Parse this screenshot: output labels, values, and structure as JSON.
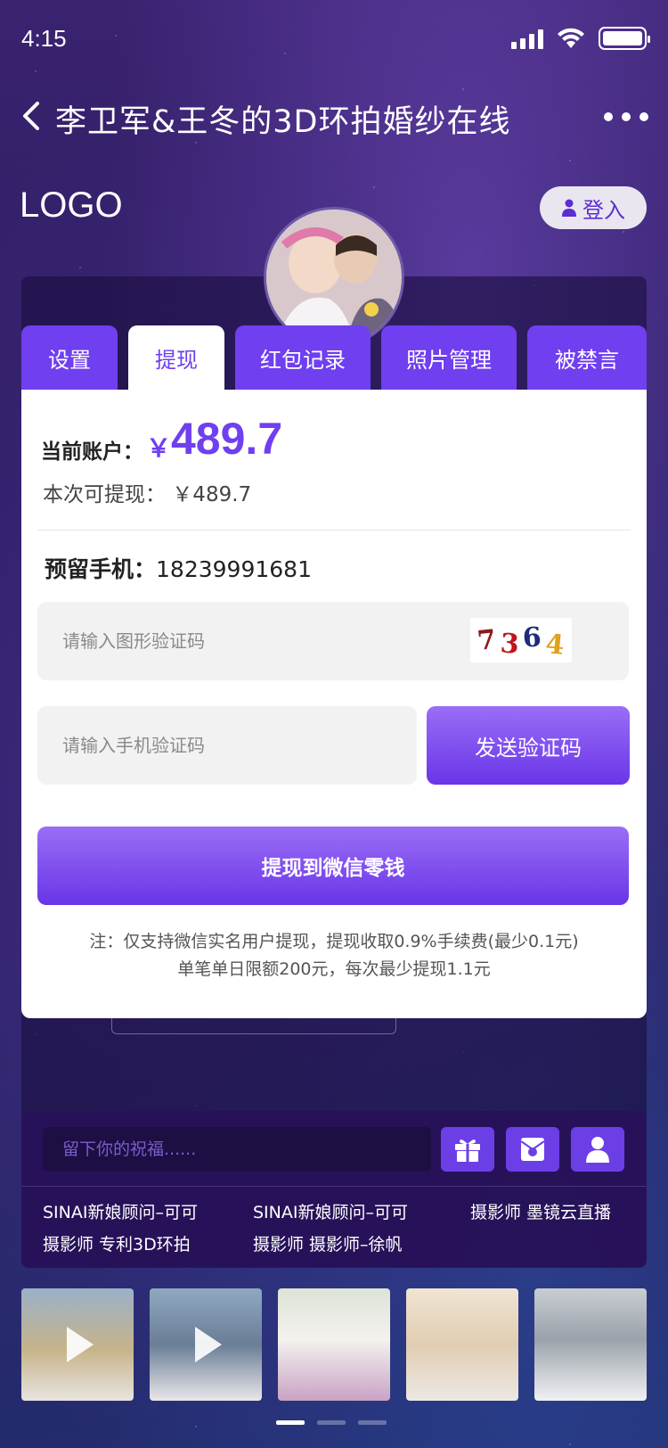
{
  "status_bar": {
    "time": "4:15"
  },
  "nav": {
    "title": "李卫军&王冬的3D环拍婚纱在线"
  },
  "header": {
    "logo": "LOGO",
    "login_label": "登入"
  },
  "tabs": [
    {
      "label": "设置",
      "active": false
    },
    {
      "label": "提现",
      "active": true
    },
    {
      "label": "红包记录",
      "active": false
    },
    {
      "label": "照片管理",
      "active": false
    },
    {
      "label": "被禁言",
      "active": false
    }
  ],
  "withdraw": {
    "account_label": "当前账户：",
    "currency": "￥",
    "account_amount": "489.7",
    "available_text": "本次可提现： ￥489.7",
    "phone_label": "预留手机：",
    "phone_number": "18239991681",
    "captcha_placeholder": "请输入图形验证码",
    "captcha_digits": [
      "7",
      "3",
      "6",
      "4"
    ],
    "captcha_colors": [
      "#8b1a1a",
      "#c0141c",
      "#1f2a7a",
      "#e0a020"
    ],
    "sms_placeholder": "请输入手机验证码",
    "send_code_label": "发送验证码",
    "submit_label": "提现到微信零钱",
    "note_line1": "注：仅支持微信实名用户提现，提现收取0.9%手续费(最少0.1元)",
    "note_line2": "单笔单日限额200元，每次最少提现1.1元"
  },
  "comment": {
    "input_placeholder": "留下你的祝福......",
    "icons": [
      "gift-icon",
      "red-envelope-icon",
      "user-icon"
    ],
    "lines": [
      {
        "text": "SINAI新娘顾问–可可"
      },
      {
        "text": "SINAI新娘顾问–可可"
      },
      {
        "text": "摄影师   墨镜云直播"
      },
      {
        "text": "摄影师   专利3D环拍"
      },
      {
        "text": "摄影师   摄影师–徐帆"
      }
    ]
  },
  "thumbnails": [
    {
      "type": "video"
    },
    {
      "type": "video"
    },
    {
      "type": "photo"
    },
    {
      "type": "photo"
    },
    {
      "type": "photo"
    }
  ],
  "pager": {
    "count": 3,
    "active_index": 0
  },
  "colors": {
    "accent": "#6f3ff0",
    "panel": "#ffffff",
    "background": "#2b1b5f"
  }
}
